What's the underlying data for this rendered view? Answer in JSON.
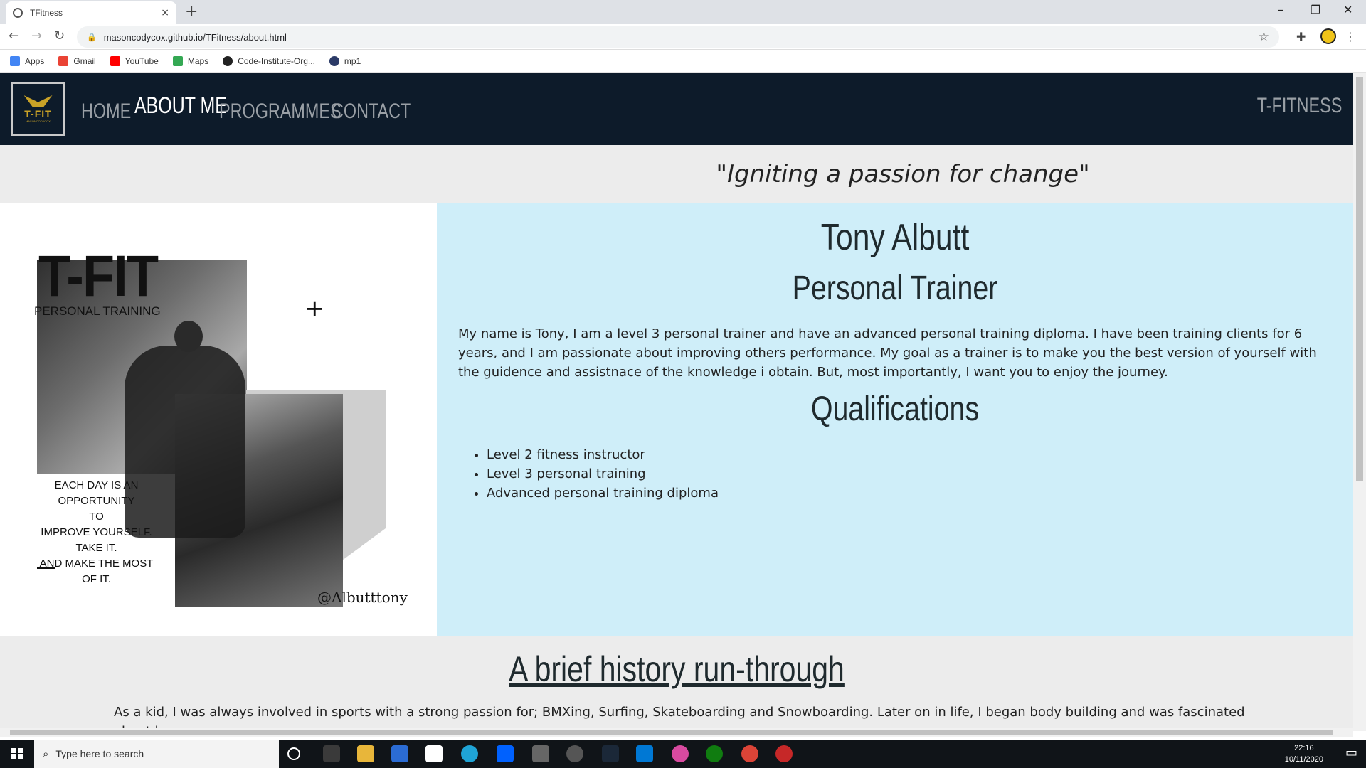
{
  "browser": {
    "tab_title": "TFitness",
    "tab_close": "×",
    "new_tab": "+",
    "window_controls": [
      "–",
      "❐",
      "✕"
    ],
    "url": "masoncodycox.github.io/TFitness/about.html",
    "bookmarks": [
      {
        "label": "Apps",
        "color": "#4285f4"
      },
      {
        "label": "Gmail",
        "color": "#ea4335"
      },
      {
        "label": "YouTube",
        "color": "#ff0000"
      },
      {
        "label": "Maps",
        "color": "#34a853"
      },
      {
        "label": "Code-Institute-Org...",
        "color": "#222222"
      },
      {
        "label": "mp1",
        "color": "#2b3a67"
      }
    ]
  },
  "nav": {
    "logo_text": "T-FIT",
    "logo_sub": "MASONCODYCOX",
    "home": "HOME",
    "about": "ABOUT ME",
    "programmes": "PROGRAMMES",
    "contact": "CONTACT",
    "brand": "T-FITNESS"
  },
  "tagline": "\"Igniting a passion for change\"",
  "poster": {
    "big": "T-FIT",
    "sub": "PERSONAL TRAINING",
    "quote": "EACH DAY IS AN OPPORTUNITY\nTO\nIMPROVE YOURSELF.\nTAKE IT.\nAND MAKE THE MOST\nOF IT.",
    "handle": "@Albutttony"
  },
  "about": {
    "name": "Tony Albutt",
    "role": "Personal Trainer",
    "bio": "My name is Tony, I am a level 3 personal trainer and have an advanced personal training diploma. I have been training clients for 6 years, and I am passionate about improving others performance. My goal as a trainer is to make you the best version of yourself with the guidence and assistnace of the knowledge i obtain. But, most importantly, I want you to enjoy the journey.",
    "qualifications_title": "Qualifications",
    "qualifications": [
      "Level 2 fitness instructor",
      "Level 3 personal training",
      "Advanced personal training diploma"
    ]
  },
  "history": {
    "title": "A brief history run-through",
    "text": "As a kid, I was always involved in sports with a strong passion for; BMXing, Surfing, Skateboarding and Snowboarding. Later on in life, I began body building and was fascinated about how"
  },
  "taskbar": {
    "search_placeholder": "Type here to search",
    "time": "22:16",
    "date": "10/11/2020"
  }
}
